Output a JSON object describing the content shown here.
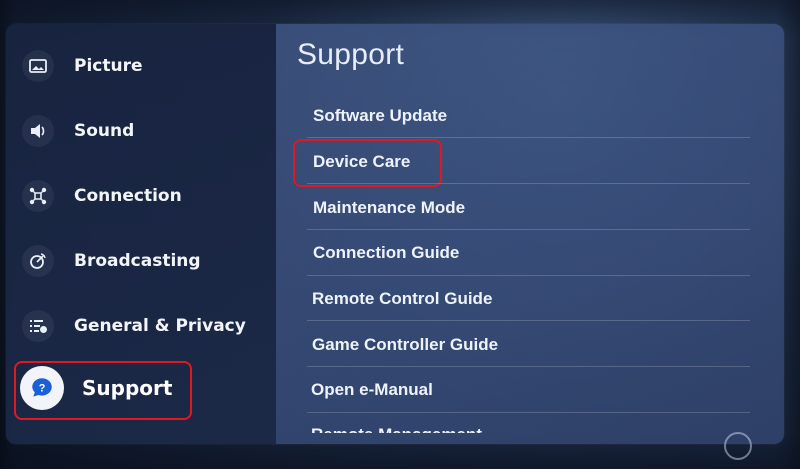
{
  "sidebar": {
    "items": [
      {
        "label": "Picture",
        "icon": "picture-icon"
      },
      {
        "label": "Sound",
        "icon": "speaker-icon"
      },
      {
        "label": "Connection",
        "icon": "connection-icon"
      },
      {
        "label": "Broadcasting",
        "icon": "broadcast-icon"
      },
      {
        "label": "General & Privacy",
        "icon": "general-privacy-icon"
      },
      {
        "label": "Support",
        "icon": "support-icon",
        "selected": true
      }
    ]
  },
  "main": {
    "title": "Support",
    "items": [
      "Software Update",
      "Device Care",
      "Maintenance Mode",
      "Connection Guide",
      "Remote Control Guide",
      "Game Controller Guide",
      "Open e-Manual",
      "Remote Management"
    ]
  },
  "colors": {
    "highlight": "#e0191f",
    "panel": "#233458",
    "text": "#eef2fa"
  }
}
